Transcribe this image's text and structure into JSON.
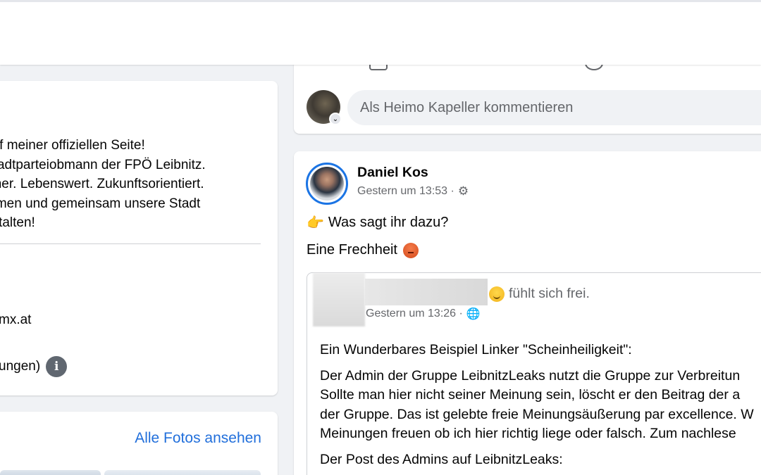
{
  "intro": {
    "bio_lines": [
      " auf meiner offiziellen Seite!",
      " Stadtparteiobmann der FPÖ Leibnitz.",
      "icher. Lebenswert. Zukunftsorientiert.",
      "mmen und gemeinsam unsere Stadt",
      "estalten!"
    ],
    "email": "mx.at",
    "rating": "ungen)"
  },
  "photos": {
    "all_link": "Alle Fotos ansehen"
  },
  "comment": {
    "placeholder": "Als Heimo Kapeller kommentieren"
  },
  "post": {
    "author": "Daniel Kos",
    "time": "Gestern um 13:53 ·",
    "line1": "Was sagt ihr dazu?",
    "line2": "Eine Frechheit",
    "shared": {
      "feeling": "fühlt sich frei.",
      "time": "Gestern um 13:26 ·",
      "paragraphs": [
        [
          "Ein Wunderbares Beispiel Linker \"Scheinheiligkeit\":"
        ],
        [
          "Der Admin der Gruppe LeibnitzLeaks nutzt die Gruppe zur Verbreitun",
          "Sollte man hier nicht seiner Meinung sein, löscht er den Beitrag der a",
          "der Gruppe. Das ist gelebte freie Meinungsäußerung par excellence. W",
          "Meinungen freuen ob ich hier richtig liege oder falsch. Zum nachlese"
        ],
        [
          "Der Post des Admins auf LeibnitzLeaks:"
        ]
      ]
    }
  }
}
